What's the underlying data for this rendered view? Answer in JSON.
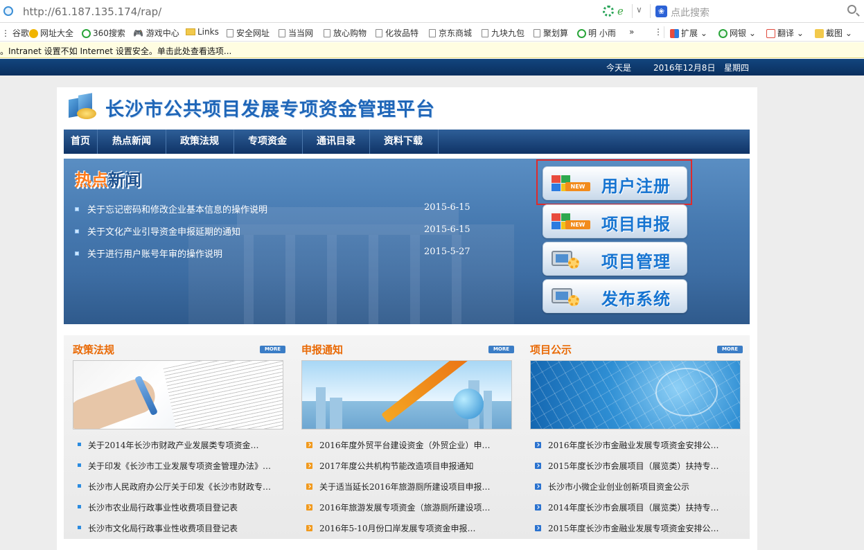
{
  "browser": {
    "url": "http://61.187.135.174/rap/",
    "search_placeholder": "点此搜索",
    "bookmarks": [
      "谷歌",
      "网址大全",
      "360搜索",
      "游戏中心",
      "Links",
      "安全网址",
      "当当网",
      "放心购物",
      "化妆品特",
      "京东商城",
      "九块九包",
      "聚划算",
      "明 小雨"
    ],
    "overflow": "»",
    "tools": [
      "扩展",
      "网银",
      "翻译",
      "截图"
    ],
    "info_bar": "。Intranet 设置不如 Internet 设置安全。单击此处查看选项..."
  },
  "topbar": {
    "today_label": "今天是",
    "date": "2016年12月8日",
    "weekday": "星期四"
  },
  "site": {
    "title": "长沙市公共项目发展专项资金管理平台"
  },
  "nav": [
    "首页",
    "热点新闻",
    "政策法规",
    "专项资金",
    "通讯目录",
    "资料下载"
  ],
  "hot_news": {
    "title_hot": "热点",
    "title_news": "新闻",
    "items": [
      {
        "text": "关于忘记密码和修改企业基本信息的操作说明",
        "date": "2015-6-15"
      },
      {
        "text": "关于文化产业引导资金申报延期的通知",
        "date": "2015-6-15"
      },
      {
        "text": "关于进行用户账号年审的操作说明",
        "date": "2015-5-27"
      }
    ]
  },
  "quick_buttons": [
    {
      "label": "用户注册",
      "badge": "NEW"
    },
    {
      "label": "项目申报",
      "badge": "NEW"
    },
    {
      "label": "项目管理",
      "badge": ""
    },
    {
      "label": "发布系统",
      "badge": ""
    }
  ],
  "sections": [
    {
      "title": "政策法规",
      "more": "MORE",
      "items": [
        "关于2014年长沙市财政产业发展类专项资金…",
        "关于印发《长沙市工业发展专项资金管理办法》…",
        "长沙市人民政府办公厅关于印发《长沙市财政专…",
        "长沙市农业局行政事业性收费项目登记表",
        "长沙市文化局行政事业性收费项目登记表"
      ]
    },
    {
      "title": "申报通知",
      "more": "MORE",
      "items": [
        "2016年度外贸平台建设资金（外贸企业）申…",
        "2017年度公共机构节能改造项目申报通知",
        "关于适当延长2016年旅游厕所建设项目申报…",
        "2016年旅游发展专项资金（旅游厕所建设项…",
        "2016年5-10月份口岸发展专项资金申报…"
      ]
    },
    {
      "title": "项目公示",
      "more": "MORE",
      "items": [
        "2016年度长沙市金融业发展专项资金安排公…",
        "2015年度长沙市会展项目（展览类）扶持专…",
        "长沙市小微企业创业创新项目资金公示",
        "2014年度长沙市会展项目（展览类）扶持专…",
        "2015年度长沙市金融业发展专项资金安排公…"
      ]
    }
  ]
}
